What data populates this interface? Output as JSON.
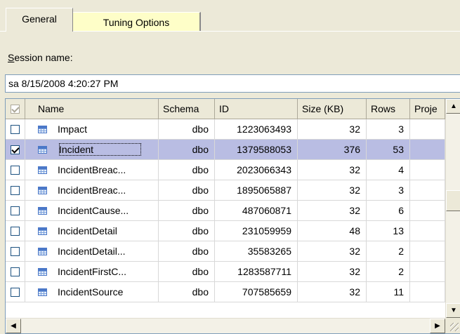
{
  "tabs": [
    {
      "label": "General",
      "active": true
    },
    {
      "label": "Tuning Options",
      "active": false
    }
  ],
  "session": {
    "label_prefix": "",
    "label_mnemonic": "S",
    "label_rest": "ession name:",
    "value": "sa 8/15/2008 4:20:27 PM"
  },
  "grid": {
    "columns": [
      "Name",
      "Schema",
      "ID",
      "Size (KB)",
      "Rows",
      "Proje"
    ],
    "rows": [
      {
        "checked": false,
        "name": "Impact",
        "schema": "dbo",
        "id": "1223063493",
        "size": "32",
        "rows": "3",
        "selected": false
      },
      {
        "checked": true,
        "name": "Incident",
        "schema": "dbo",
        "id": "1379588053",
        "size": "376",
        "rows": "53",
        "selected": true
      },
      {
        "checked": false,
        "name": "IncidentBreac...",
        "schema": "dbo",
        "id": "2023066343",
        "size": "32",
        "rows": "4",
        "selected": false
      },
      {
        "checked": false,
        "name": "IncidentBreac...",
        "schema": "dbo",
        "id": "1895065887",
        "size": "32",
        "rows": "3",
        "selected": false
      },
      {
        "checked": false,
        "name": "IncidentCause...",
        "schema": "dbo",
        "id": "487060871",
        "size": "32",
        "rows": "6",
        "selected": false
      },
      {
        "checked": false,
        "name": "IncidentDetail",
        "schema": "dbo",
        "id": "231059959",
        "size": "48",
        "rows": "13",
        "selected": false
      },
      {
        "checked": false,
        "name": "IncidentDetail...",
        "schema": "dbo",
        "id": "35583265",
        "size": "32",
        "rows": "2",
        "selected": false
      },
      {
        "checked": false,
        "name": "IncidentFirstC...",
        "schema": "dbo",
        "id": "1283587711",
        "size": "32",
        "rows": "2",
        "selected": false
      },
      {
        "checked": false,
        "name": "IncidentSource",
        "schema": "dbo",
        "id": "707585659",
        "size": "32",
        "rows": "11",
        "selected": false
      }
    ]
  },
  "icons": {
    "row_icon": "table-icon",
    "scroll_up": "▲",
    "scroll_down": "▼",
    "scroll_left": "◀",
    "scroll_right": "▶"
  },
  "colors": {
    "window_bg": "#ece9d8",
    "selected_row": "#b9bde3",
    "inactive_tab": "#fefec8"
  }
}
